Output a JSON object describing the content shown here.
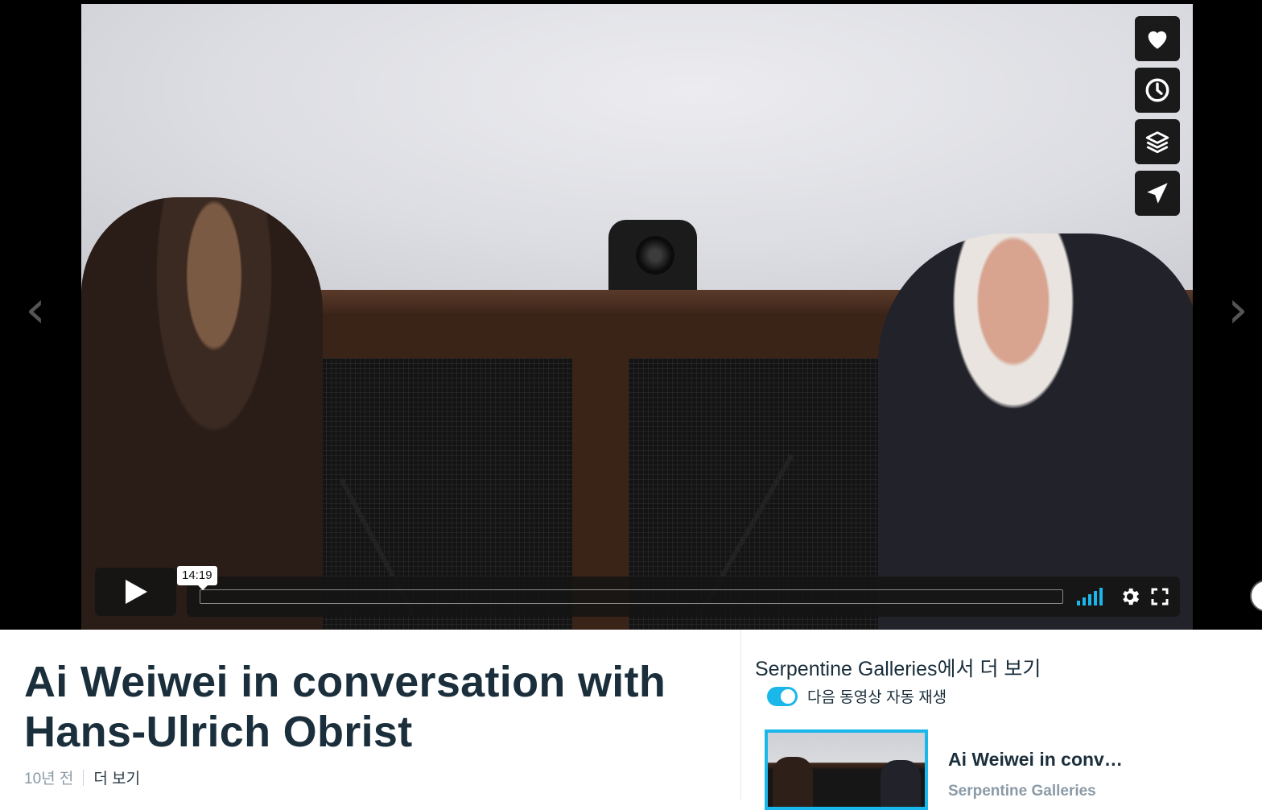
{
  "player": {
    "current_time": "14:19",
    "progress": 0,
    "volume_level_bars": 5,
    "accent_color": "#1ab7ea",
    "icons": {
      "prev": "chevron-left-icon",
      "next": "chevron-right-icon",
      "like": "heart-icon",
      "watch_later": "clock-icon",
      "collections": "layers-icon",
      "share": "paper-plane-icon",
      "play": "play-icon",
      "volume": "volume-bars-icon",
      "settings": "gear-icon",
      "fullscreen": "fullscreen-icon"
    }
  },
  "video": {
    "title": "Ai Weiwei in conversation with Hans-Ulrich Obrist",
    "age": "10년 전",
    "more_link": "더 보기"
  },
  "sidebar": {
    "heading": "Serpentine Galleries에서 더 보기",
    "autoplay_label": "다음 동영상 자동 재생",
    "autoplay_on": true,
    "related": [
      {
        "title": "Ai Weiwei in conv…",
        "channel": "Serpentine Galleries"
      }
    ]
  }
}
